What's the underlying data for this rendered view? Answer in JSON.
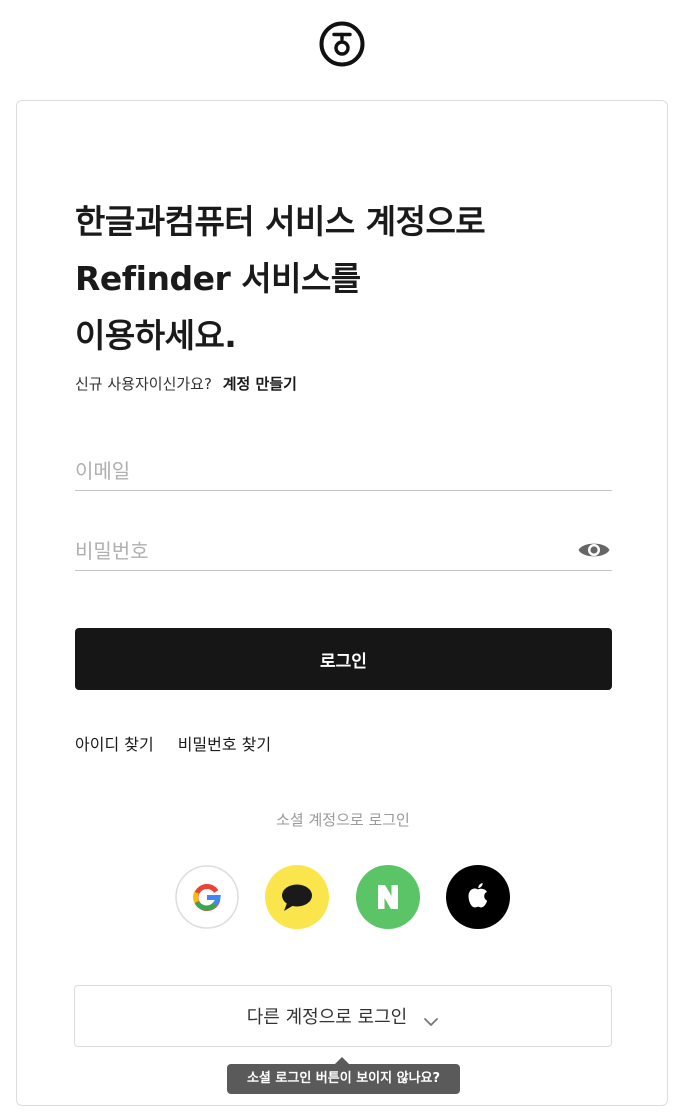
{
  "logo": {
    "icon": "hancom-logo-icon"
  },
  "headline": {
    "line1": "한글과컴퓨터 서비스 계정으로",
    "line2": "Refinder 서비스를",
    "line3": "이용하세요."
  },
  "signup": {
    "prompt": "신규 사용자이신가요?",
    "link": "계정 만들기"
  },
  "form": {
    "email_placeholder": "이메일",
    "password_placeholder": "비밀번호",
    "login_label": "로그인"
  },
  "find": {
    "id": "아이디 찾기",
    "password": "비밀번호 찾기"
  },
  "social": {
    "title": "소셜 계정으로 로그인",
    "providers": [
      {
        "name": "google",
        "icon": "google-icon",
        "color": "#ffffff"
      },
      {
        "name": "kakao",
        "icon": "kakao-icon",
        "color": "#fae64c"
      },
      {
        "name": "naver",
        "icon": "naver-icon",
        "color": "#5ac466"
      },
      {
        "name": "apple",
        "icon": "apple-icon",
        "color": "#000000"
      }
    ]
  },
  "other": {
    "label": "다른 계정으로 로그인",
    "tooltip": "소셜 로그인 버튼이 보이지 않나요?"
  },
  "colors": {
    "primary_button": "#161616",
    "input_border": "#c4c4c4",
    "tooltip_bg": "#5a5a5a"
  }
}
